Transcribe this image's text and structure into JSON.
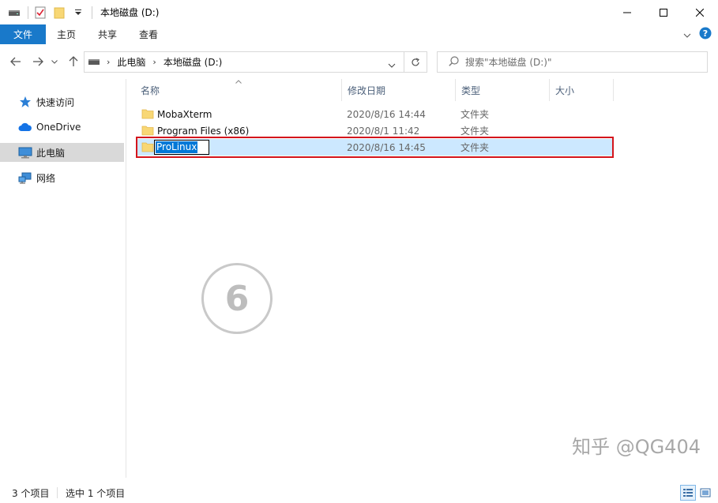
{
  "window": {
    "title": "本地磁盘 (D:)",
    "controls": [
      "minimize",
      "maximize",
      "close"
    ]
  },
  "ribbon": {
    "tabs": [
      {
        "label": "文件",
        "active": true
      },
      {
        "label": "主页"
      },
      {
        "label": "共享"
      },
      {
        "label": "查看"
      }
    ]
  },
  "nav": {
    "breadcrumb": [
      "此电脑",
      "本地磁盘 (D:)"
    ],
    "search_placeholder": "搜索\"本地磁盘 (D:)\""
  },
  "sidebar": {
    "items": [
      {
        "label": "快速访问",
        "icon": "star-icon"
      },
      {
        "label": "OneDrive",
        "icon": "cloud-icon"
      },
      {
        "label": "此电脑",
        "icon": "computer-icon",
        "selected": true
      },
      {
        "label": "网络",
        "icon": "network-icon"
      }
    ]
  },
  "columns": {
    "name": "名称",
    "date": "修改日期",
    "type": "类型",
    "size": "大小"
  },
  "files": [
    {
      "name": "MobaXterm",
      "date": "2020/8/16 14:44",
      "type": "文件夹"
    },
    {
      "name": "Program Files (x86)",
      "date": "2020/8/1 11:42",
      "type": "文件夹"
    },
    {
      "name": "ProLinux",
      "date": "2020/8/16 14:45",
      "type": "文件夹",
      "renaming": true
    }
  ],
  "step_number": "6",
  "watermark": "知乎 @QG404",
  "status": {
    "item_count": "3 个项目",
    "selected_count": "选中 1 个项目"
  },
  "colors": {
    "accent": "#1979ca",
    "selection": "#cce8ff",
    "highlight_border": "#d4151c",
    "folder": "#f8d775"
  }
}
